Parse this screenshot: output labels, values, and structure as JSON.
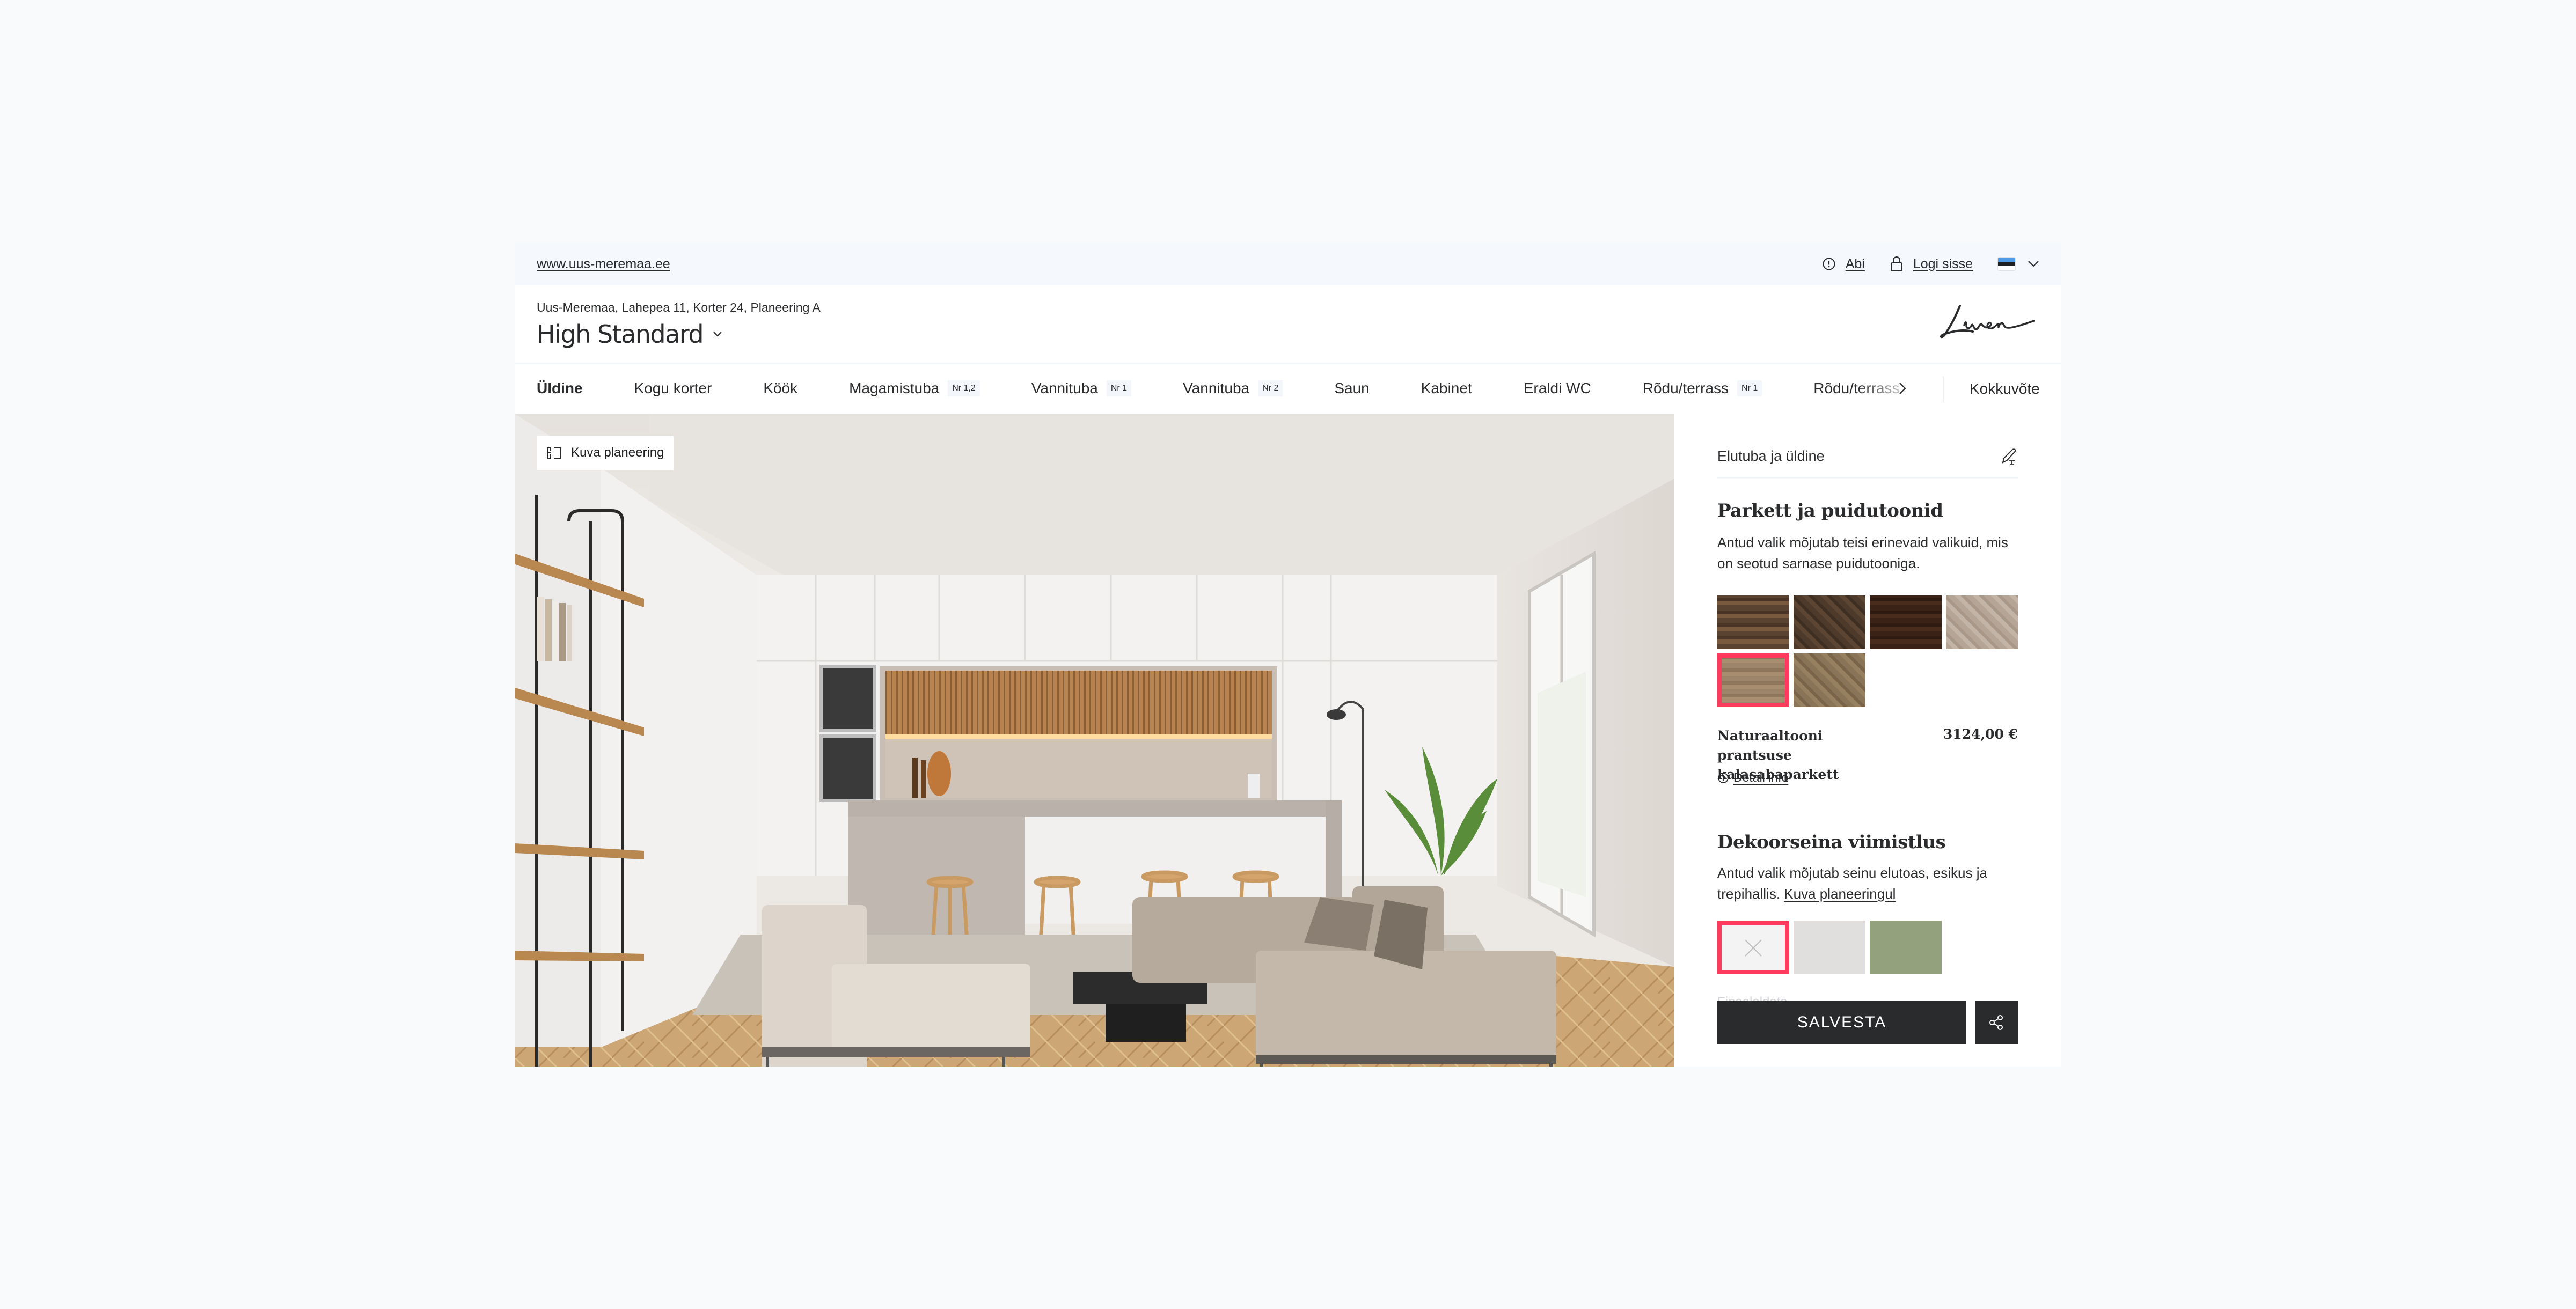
{
  "topbar": {
    "site_link": "www.uus-meremaa.ee",
    "help_label": "Abi",
    "login_label": "Logi sisse",
    "language": "Eesti",
    "flag_colors": [
      "#4f9be8",
      "#1f2022",
      "#ffffff"
    ]
  },
  "header": {
    "address": "Uus-Meremaa, Lahepea 11, Korter 24, Planeering A",
    "package": "High Standard",
    "logo": "Liven"
  },
  "nav": {
    "items": [
      {
        "label": "Üldine",
        "badge": null,
        "active": true
      },
      {
        "label": "Kogu korter",
        "badge": null
      },
      {
        "label": "Köök",
        "badge": null
      },
      {
        "label": "Magamistuba",
        "badge": "Nr 1,2"
      },
      {
        "label": "Vannituba",
        "badge": "Nr 1"
      },
      {
        "label": "Vannituba",
        "badge": "Nr 2"
      },
      {
        "label": "Saun",
        "badge": null
      },
      {
        "label": "Kabinet",
        "badge": null
      },
      {
        "label": "Eraldi WC",
        "badge": null
      },
      {
        "label": "Rõdu/terrass",
        "badge": "Nr 1"
      },
      {
        "label": "Rõdu/terrass",
        "badge": null
      }
    ],
    "summary": "Kokkuvõte"
  },
  "hero": {
    "plan_button": "Kuva planeering"
  },
  "panel": {
    "room": "Elutuba ja üldine",
    "sections": [
      {
        "title": "Parkett ja puidutoonid",
        "description": "Antud valik mõjutab teisi erinevaid valikuid, mis on seotud sarnase puidutooniga.",
        "swatches": [
          {
            "name": "reclaimed-plank",
            "colors": [
              "#5b4331",
              "#7a5a3e",
              "#4a3527"
            ],
            "selected": false
          },
          {
            "name": "dark-herringbone",
            "colors": [
              "#4e3a2a",
              "#5c4532",
              "#3f2f22"
            ],
            "selected": false
          },
          {
            "name": "dark-walnut-plank",
            "colors": [
              "#3a2216",
              "#4a2c1c",
              "#2e1a11"
            ],
            "selected": false
          },
          {
            "name": "light-grey-chevron",
            "colors": [
              "#b5a596",
              "#c2b4a6",
              "#a99888"
            ],
            "selected": false
          },
          {
            "name": "natural-chevron",
            "colors": [
              "#9c8468",
              "#a88f72",
              "#8e775d"
            ],
            "selected": true
          },
          {
            "name": "rustic-chevron",
            "colors": [
              "#8a7458",
              "#97805f",
              "#7a6449"
            ],
            "selected": false
          }
        ],
        "selected_name": "Naturaaltooni prantsuse kalasabaparkett",
        "selected_price": "3124,00 €",
        "detail_label": "Detail info"
      },
      {
        "title": "Dekoorseina viimistlus",
        "description": "Antud valik mõjutab seinu elutoas, esikus ja trepihallis.",
        "link": "Kuva planeeringul",
        "swatches": [
          {
            "name": "none",
            "colors": [
              "#f3f3f3"
            ],
            "selected": true
          },
          {
            "name": "light-grey",
            "colors": [
              "#e0dfde"
            ],
            "selected": false
          },
          {
            "name": "sage-green",
            "colors": [
              "#93a27c"
            ],
            "selected": false
          }
        ],
        "ghost_text": "Finaalaldata"
      }
    ],
    "save_label": "SALVESTA"
  },
  "colors": {
    "accent": "#ff3a5f",
    "dark": "#2a2b2d",
    "topbar_bg": "#f5f8fc"
  }
}
